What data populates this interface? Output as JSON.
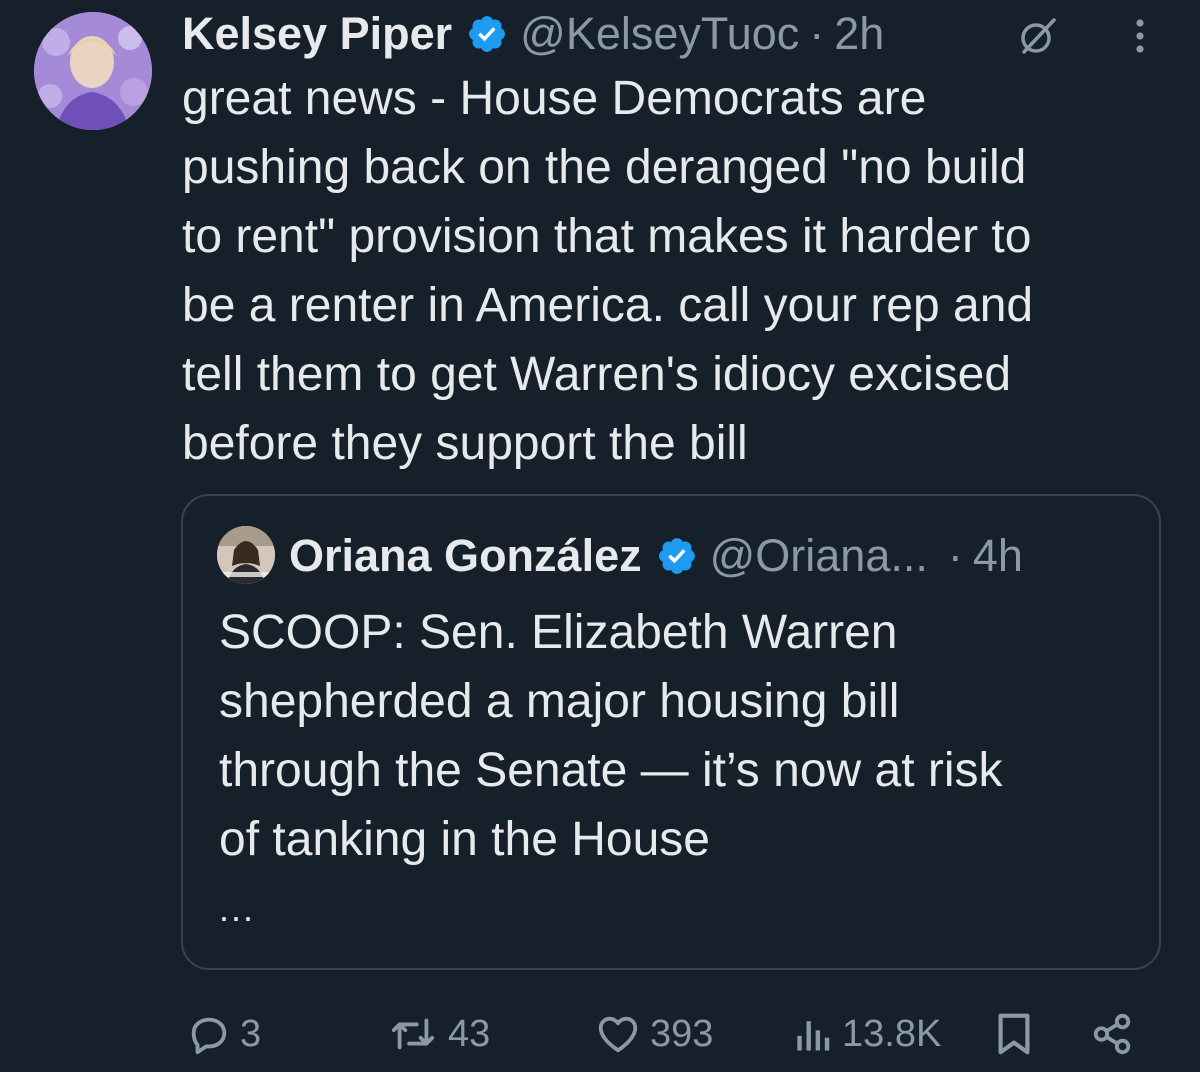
{
  "tweet": {
    "author_name": "Kelsey Piper",
    "author_handle": "@KelseyTuoc",
    "separator": "·",
    "time": "2h",
    "text": "great news - House Democrats are\npushing back on the deranged \"no build\nto rent\" provision that makes it harder to\nbe a renter in America. call your rep and\ntell them to get Warren's idiocy excised\nbefore they support the bill"
  },
  "quote": {
    "author_name": "Oriana González",
    "author_handle": "@Oriana...",
    "separator": "·",
    "time": "4h",
    "text": "SCOOP: Sen. Elizabeth Warren\nshepherded a major housing bill\nthrough the Senate — it’s now at risk\nof tanking in the House",
    "ellipsis": "..."
  },
  "actions": {
    "replies": "3",
    "reposts": "43",
    "likes": "393",
    "views": "13.8K"
  },
  "colors": {
    "background": "#15202b",
    "text": "#e7e9ea",
    "muted": "#8b98a5",
    "verified": "#1d9bf0",
    "border": "#38444d"
  },
  "icons": [
    "verified-badge-icon",
    "grok-icon",
    "more-options-icon",
    "reply-icon",
    "repost-icon",
    "like-icon",
    "views-icon",
    "bookmark-icon",
    "share-icon"
  ]
}
